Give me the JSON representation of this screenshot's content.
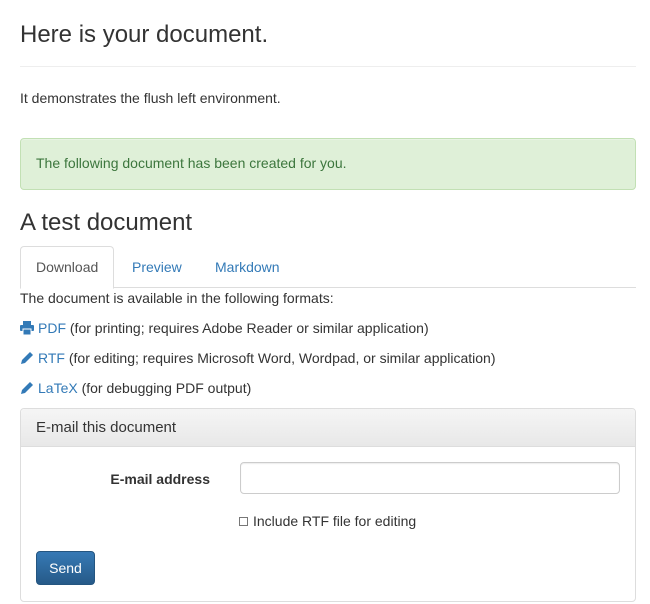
{
  "header": {
    "title": "Here is your document."
  },
  "intro": "It demonstrates the flush left environment.",
  "alert": {
    "message": "The following document has been created for you.",
    "color": "#3c763d",
    "background": "#dff0d8"
  },
  "document": {
    "title": "A test document"
  },
  "tabs": [
    {
      "label": "Download",
      "active": true
    },
    {
      "label": "Preview",
      "active": false
    },
    {
      "label": "Markdown",
      "active": false
    }
  ],
  "formats": {
    "intro": "The document is available in the following formats:",
    "items": [
      {
        "icon": "printer-icon",
        "link": "PDF",
        "desc": " (for printing; requires Adobe Reader or similar application)"
      },
      {
        "icon": "pencil-icon",
        "link": "RTF",
        "desc": " (for editing; requires Microsoft Word, Wordpad, or similar application)"
      },
      {
        "icon": "pencil-icon",
        "link": "LaTeX",
        "desc": " (for debugging PDF output)"
      }
    ]
  },
  "email_panel": {
    "title": "E-mail this document",
    "email_label": "E-mail address",
    "email_value": "",
    "email_placeholder": "",
    "checkbox_label": "Include RTF file for editing",
    "checkbox_checked": false,
    "send_label": "Send"
  },
  "colors": {
    "link": "#337ab7",
    "primary": "#2e6da4"
  }
}
